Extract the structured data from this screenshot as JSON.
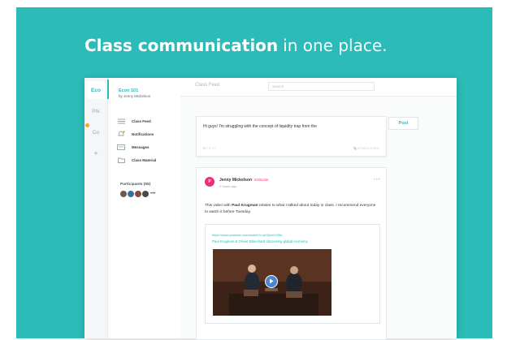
{
  "headline": {
    "bold": "Class communication",
    "light": "in one place."
  },
  "rail": {
    "items": [
      {
        "label": "Eco",
        "active": true
      },
      {
        "label": "Phi",
        "active": false
      },
      {
        "label": "Co",
        "active": false
      },
      {
        "label": "+",
        "active": false
      }
    ]
  },
  "class": {
    "name": "Econ 101",
    "author": "by Jenny Mickelson",
    "nav": [
      {
        "label": "Class Feed",
        "icon": "feed-icon"
      },
      {
        "label": "Notifications",
        "icon": "bell-icon"
      },
      {
        "label": "Messages",
        "icon": "message-icon"
      },
      {
        "label": "Class Material",
        "icon": "folder-icon"
      }
    ],
    "participants_label": "Participants (55)"
  },
  "topbar": {
    "title": "Class Feed",
    "search_placeholder": "Search"
  },
  "composer": {
    "text": "Hi guys! I'm struggling with the concept of liquidity trap from the",
    "tools": "B  I  ↗  <>",
    "attach": "ATTACH A FILE",
    "post_label": "Post"
  },
  "post": {
    "avatar_letter": "P",
    "author": "Jenny Mickelson",
    "role": "Instructor",
    "time": "2 hours ago",
    "more": "•••",
    "body_prefix": "This video with ",
    "body_bold": "Paul Krugman",
    "body_suffix": " relates to what I talked about today in class. I recommend everyone to watch it before Tuesday.",
    "link_url": "https://www.youtube.com/watch?v=pH2jcnVrXBs",
    "link_title": "Paul Krugman & Olivier Blanchard discussing global economy"
  },
  "colors": {
    "accent": "#2bbbb8",
    "instructor": "#e9307a",
    "notification": "#f5a623"
  }
}
